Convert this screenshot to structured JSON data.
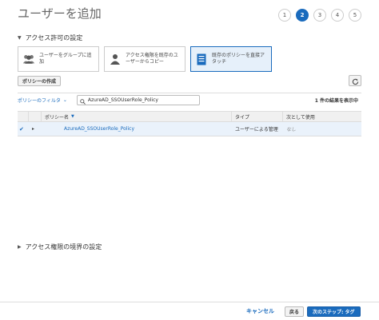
{
  "header": {
    "title": "ユーザーを追加",
    "steps": [
      "1",
      "2",
      "3",
      "4",
      "5"
    ],
    "active_step": "2"
  },
  "permissions": {
    "section_title": "アクセス許可の設定",
    "options": [
      {
        "label": "ユーザーをグループに追加",
        "icon": "group-icon",
        "selected": false
      },
      {
        "label": "アクセス権限を既存のユーザーからコピー",
        "icon": "user-icon",
        "selected": false
      },
      {
        "label": "既存のポリシーを直接アタッチ",
        "icon": "document-icon",
        "selected": true
      }
    ]
  },
  "toolbar": {
    "create_policy_label": "ポリシーの作成",
    "refresh_icon": "refresh-icon"
  },
  "filter": {
    "filter_label": "ポリシーのフィルタ",
    "search_value": "AzureAD_SSOUserRole_Policy",
    "result_count": "1 件の結果を表示中"
  },
  "table": {
    "headers": {
      "name": "ポリシー名",
      "type": "タイプ",
      "used_as": "次として使用"
    },
    "rows": [
      {
        "checked": true,
        "name": "AzureAD_SSOUserRole_Policy",
        "type": "ユーザーによる管理",
        "used_as": "なし"
      }
    ]
  },
  "boundary": {
    "section_title": "アクセス権限の境界の設定"
  },
  "footer": {
    "cancel_label": "キャンセル",
    "back_label": "戻る",
    "next_label": "次のステップ: タグ"
  },
  "colors": {
    "accent": "#1a6bbd",
    "selected_bg": "#e6f0fa",
    "row_selected_bg": "#eaf2fb"
  }
}
